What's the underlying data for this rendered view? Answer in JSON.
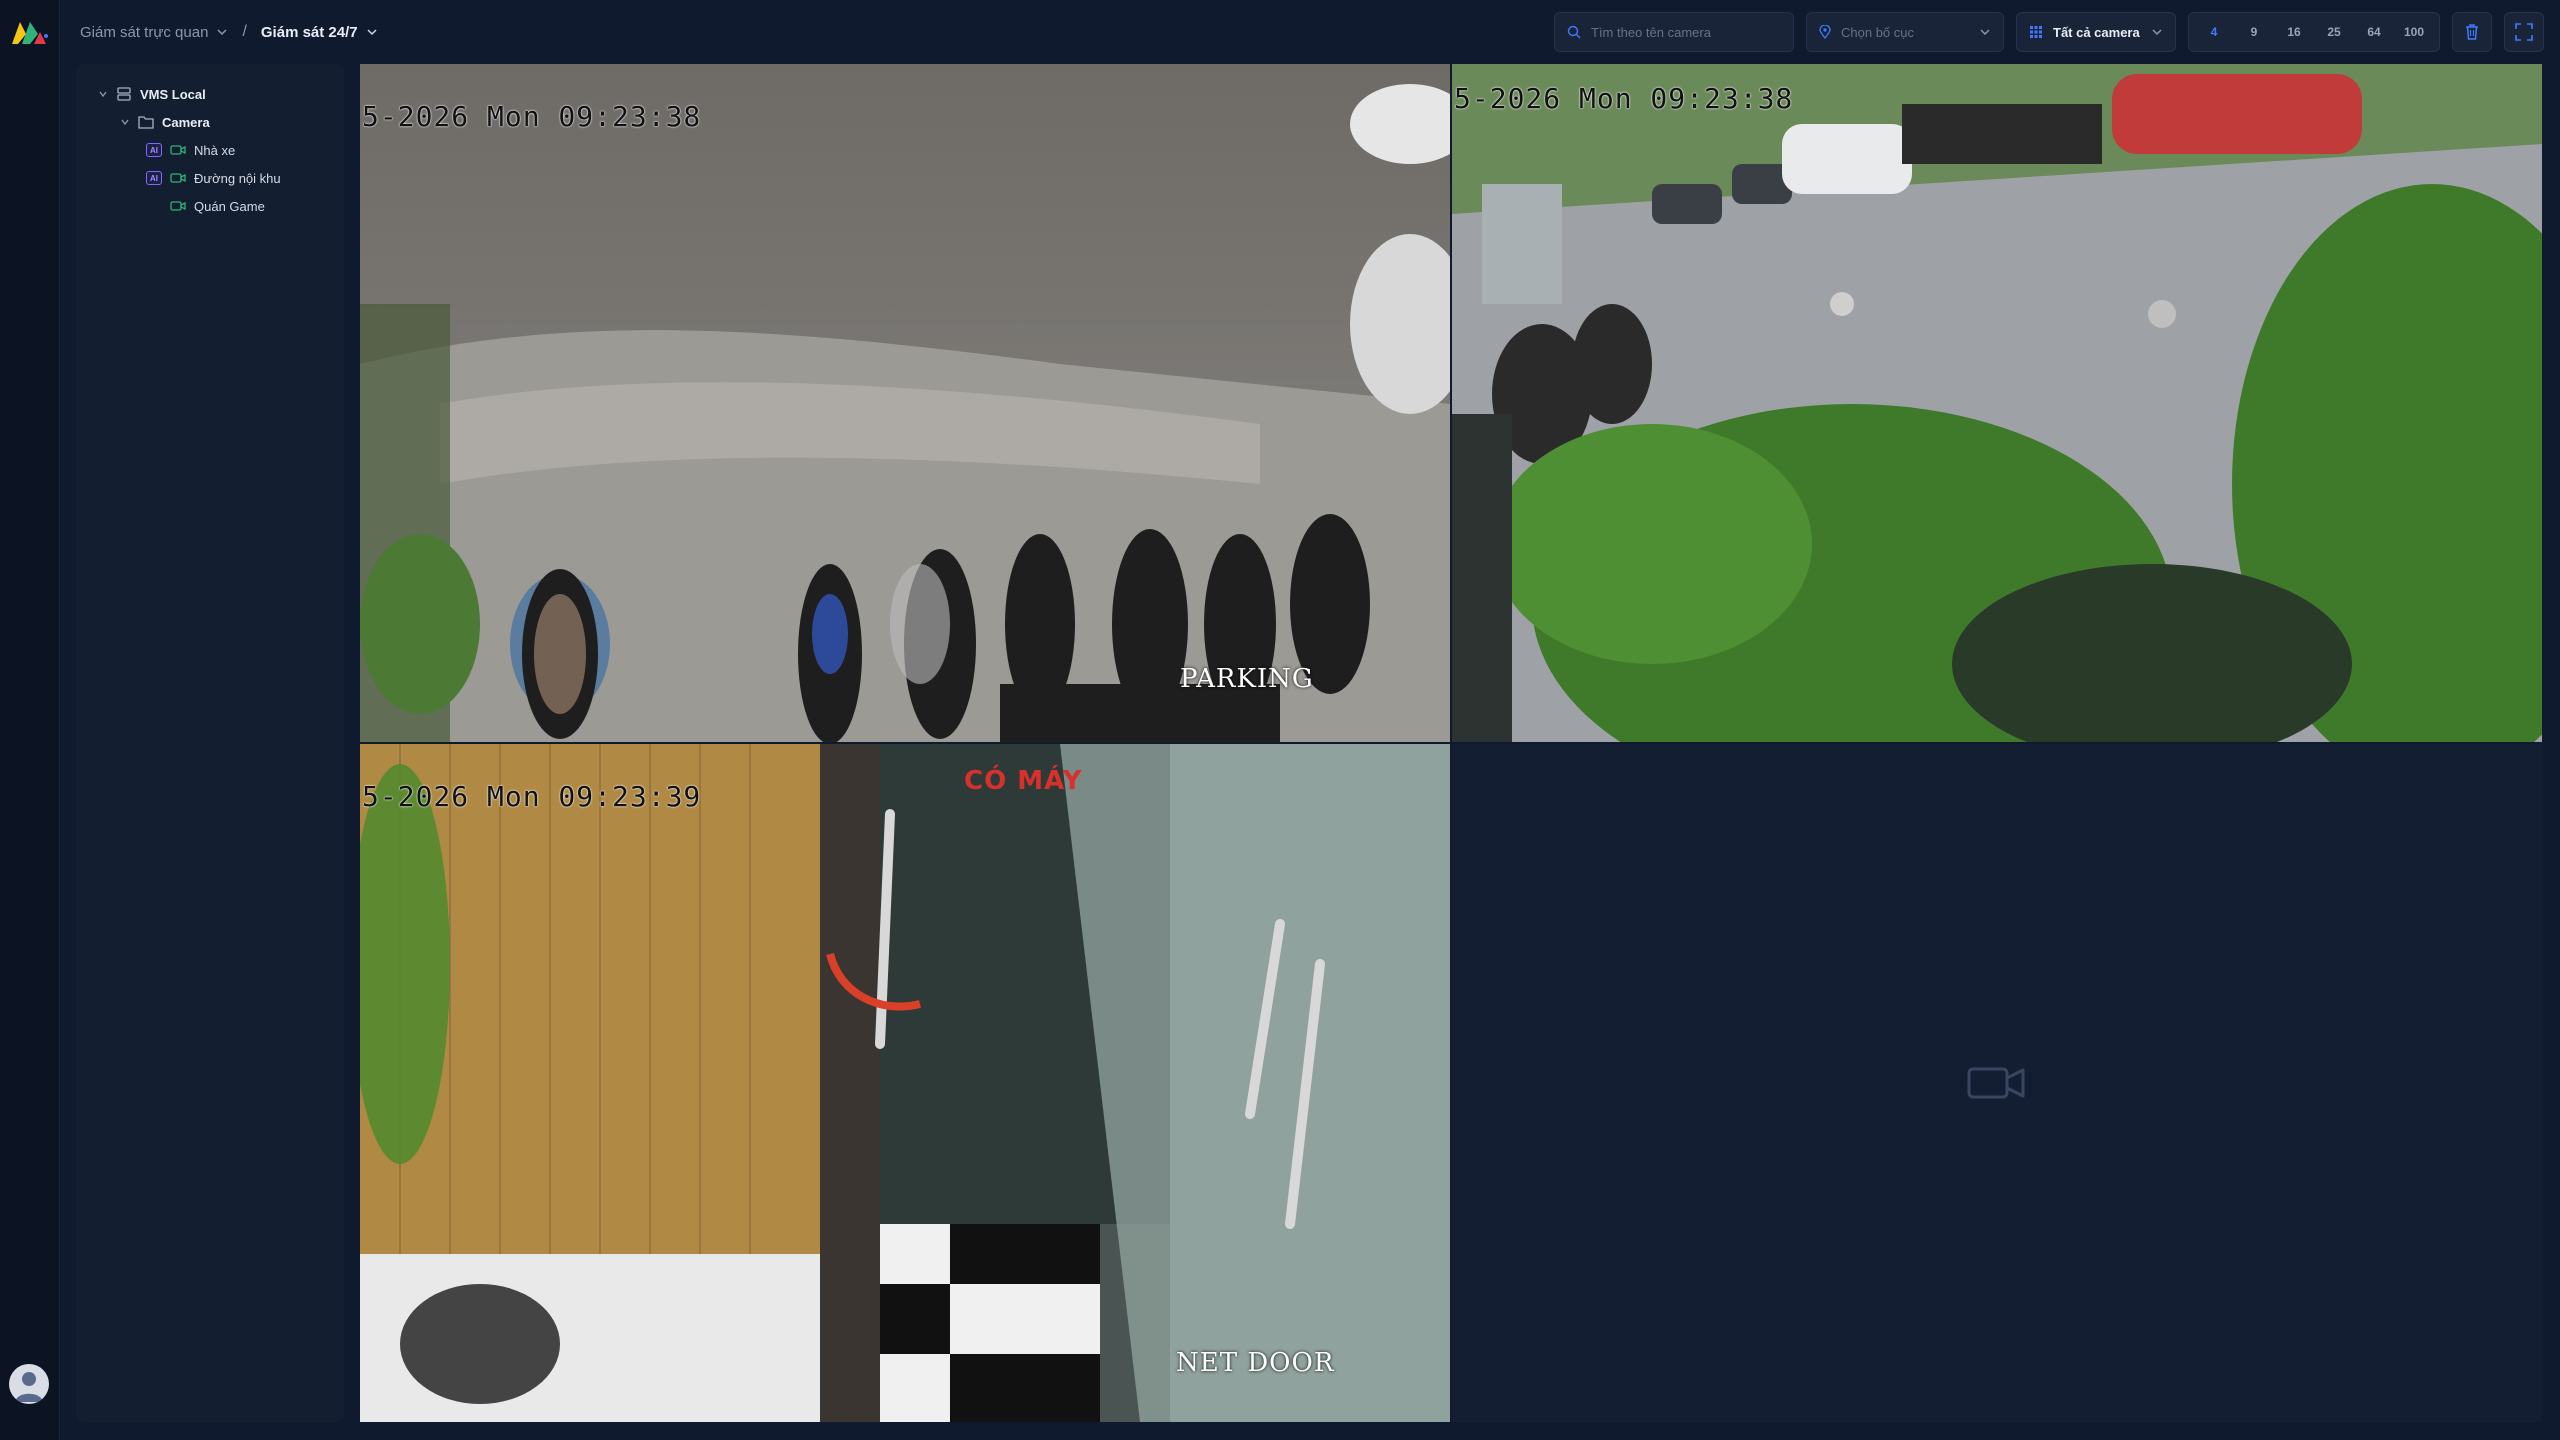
{
  "breadcrumb": {
    "root": "Giám sát trực quan",
    "current": "Giám sát 24/7"
  },
  "toolbar": {
    "search_placeholder": "Tìm theo tên camera",
    "layout_placeholder": "Chọn bố cục",
    "camera_filter": "Tất cả camera",
    "grid_options": [
      "4",
      "9",
      "16",
      "25",
      "64",
      "100"
    ],
    "grid_selected": "4"
  },
  "tree": {
    "root": "VMS Local",
    "folder": "Camera",
    "cameras": [
      {
        "name": "Nhà xe",
        "ai": true
      },
      {
        "name": "Đường nội khu",
        "ai": true
      },
      {
        "name": "Quán Game",
        "ai": false
      }
    ]
  },
  "tiles": [
    {
      "osd_time": "5-2026 Mon 09:23:38",
      "osd_label": "PARKING"
    },
    {
      "osd_time": "5-2026 Mon 09:23:38",
      "osd_label": ""
    },
    {
      "osd_time": "5-2026 Mon 09:23:39",
      "osd_label": "NET DOOR",
      "sign": "CÓ MÁY"
    }
  ],
  "colors": {
    "accent": "#3d7bff",
    "ai_badge": "#7a6cff",
    "camera_icon": "#2fb37a"
  }
}
